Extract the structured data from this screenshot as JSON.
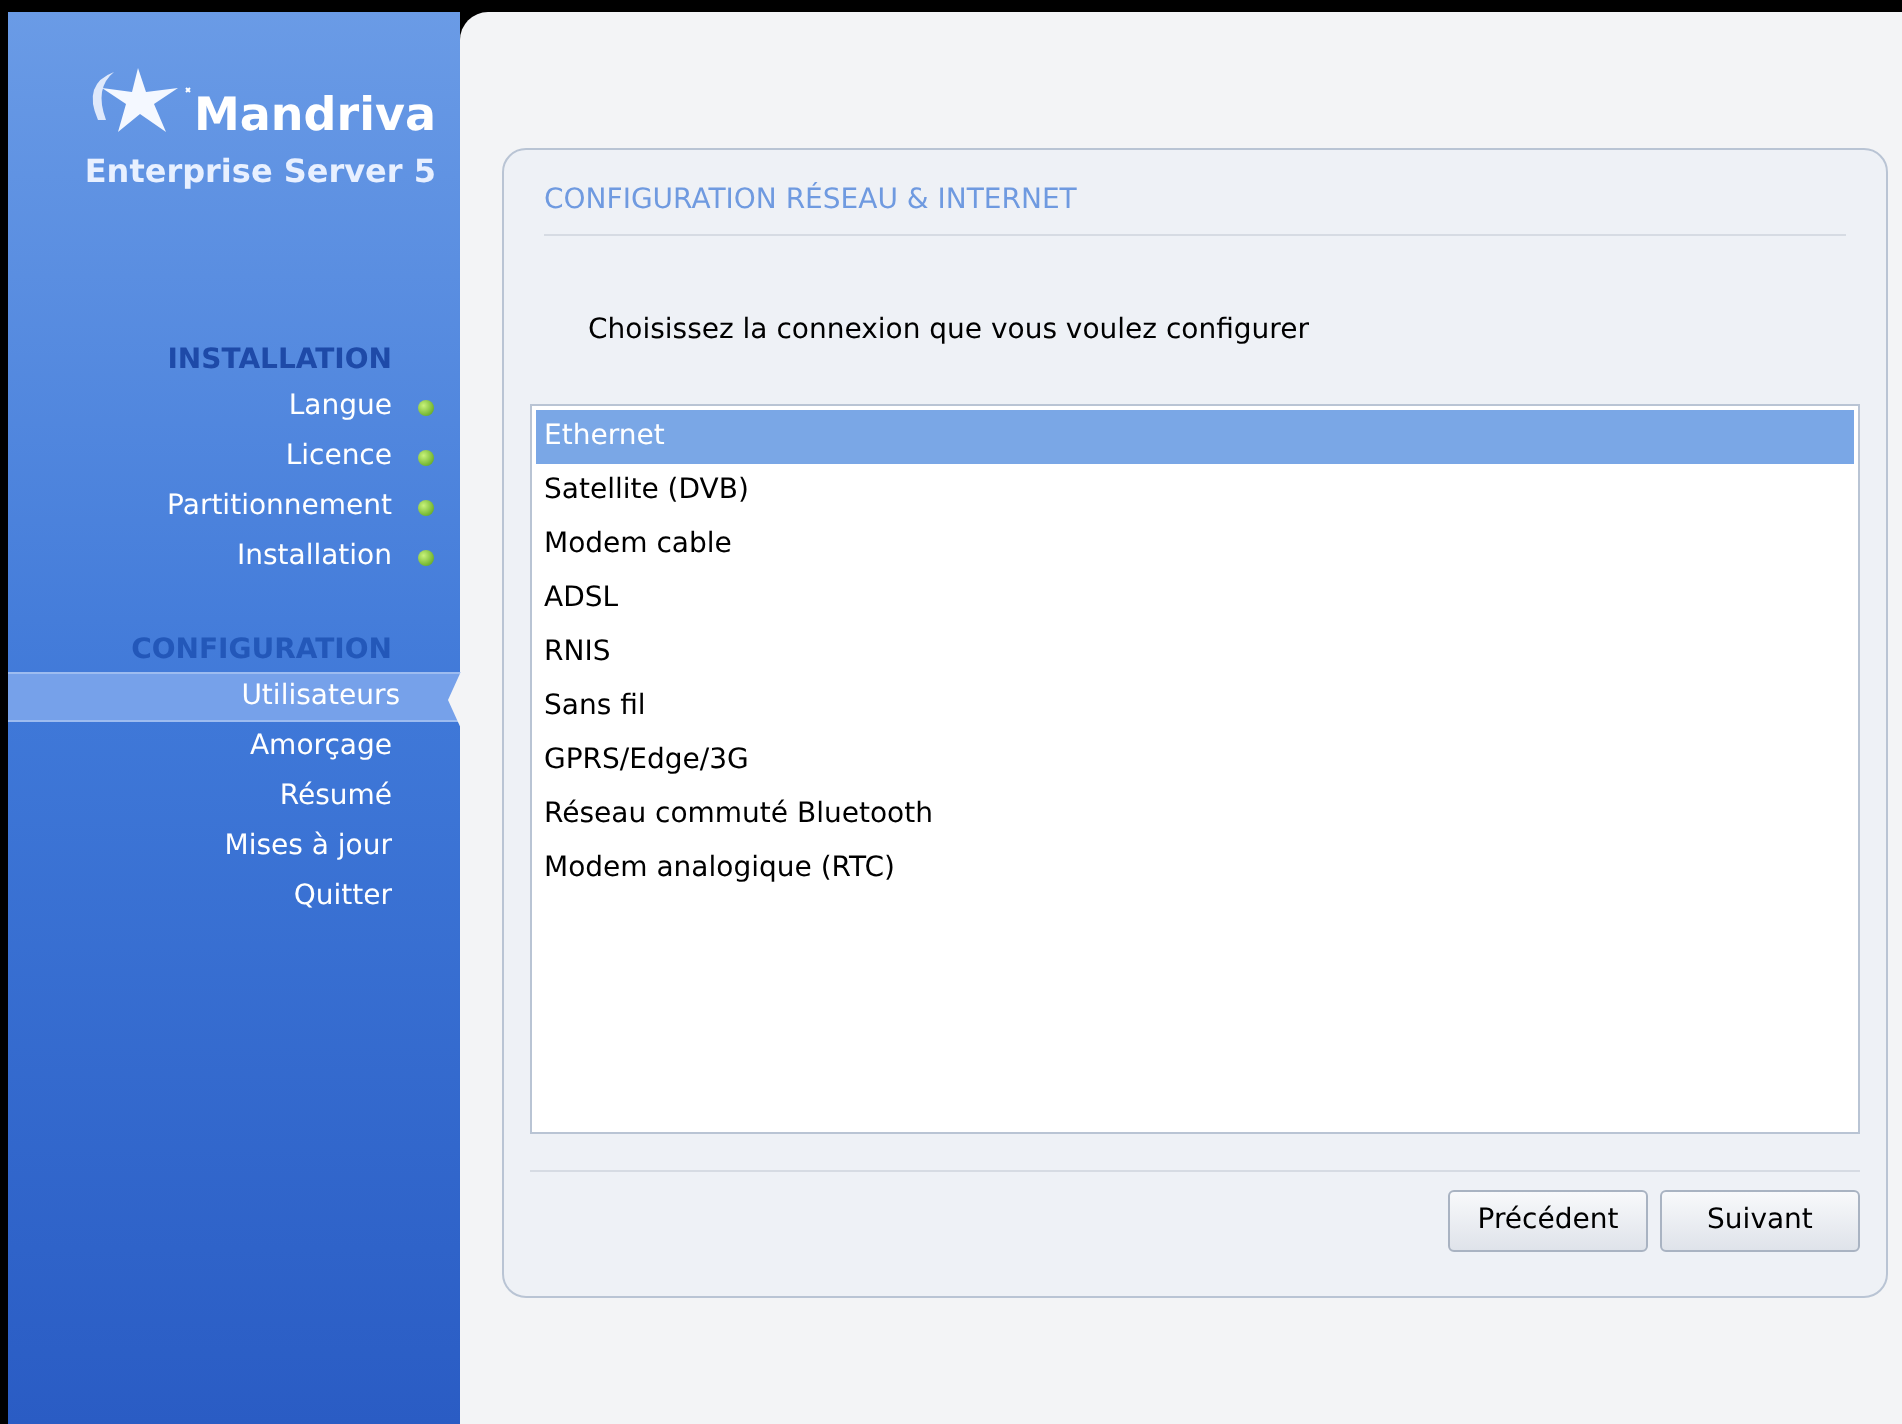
{
  "logo": {
    "name": "Mandriva",
    "product": "Enterprise Server 5"
  },
  "sidebar": {
    "sections": [
      {
        "title": "INSTALLATION",
        "active": true,
        "items": [
          {
            "label": "Langue",
            "done": true,
            "selected": false
          },
          {
            "label": "Licence",
            "done": true,
            "selected": false
          },
          {
            "label": "Partitionnement",
            "done": true,
            "selected": false
          },
          {
            "label": "Installation",
            "done": true,
            "selected": false
          }
        ]
      },
      {
        "title": "CONFIGURATION",
        "active": false,
        "items": [
          {
            "label": "Utilisateurs",
            "done": false,
            "selected": true
          },
          {
            "label": "Amorçage",
            "done": false,
            "selected": false
          },
          {
            "label": "Résumé",
            "done": false,
            "selected": false
          },
          {
            "label": "Mises à jour",
            "done": false,
            "selected": false
          },
          {
            "label": "Quitter",
            "done": false,
            "selected": false
          }
        ]
      }
    ]
  },
  "panel": {
    "title": "CONFIGURATION RÉSEAU & INTERNET",
    "prompt": "Choisissez la connexion que vous voulez configurer",
    "connections": [
      {
        "label": "Ethernet",
        "selected": true
      },
      {
        "label": "Satellite (DVB)",
        "selected": false
      },
      {
        "label": "Modem cable",
        "selected": false
      },
      {
        "label": "ADSL",
        "selected": false
      },
      {
        "label": "RNIS",
        "selected": false
      },
      {
        "label": "Sans fil",
        "selected": false
      },
      {
        "label": "GPRS/Edge/3G",
        "selected": false
      },
      {
        "label": "Réseau commuté Bluetooth",
        "selected": false
      },
      {
        "label": "Modem analogique (RTC)",
        "selected": false
      }
    ],
    "buttons": [
      "Précédent",
      "Suivant"
    ]
  }
}
